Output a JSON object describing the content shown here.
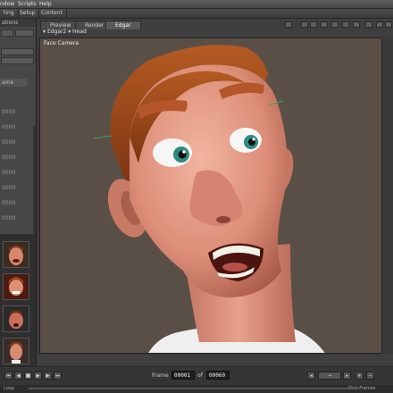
{
  "menu": {
    "items": [
      "ndow",
      "Scripts",
      "Help"
    ]
  },
  "topbar": {
    "tabs": [
      "ting",
      "Setup",
      "Content"
    ]
  },
  "left_panel": {
    "header": "ations",
    "button_labels": [
      "",
      "",
      "",
      ""
    ],
    "section_tab": "ame",
    "rows": [
      "0000",
      "0000",
      "0000",
      "0000",
      "0000",
      "0000",
      "0000",
      "0000"
    ],
    "thumbnails": [
      "face-1",
      "face-2",
      "face-3",
      "face-4"
    ]
  },
  "viewport": {
    "tabs": [
      "Preview",
      "Render",
      "Edgar"
    ],
    "active_tab": "Edgar",
    "figure": "Edgar2",
    "body_part": "Head",
    "camera": "Face Camera",
    "background_color": "#5a4f47"
  },
  "transport": {
    "frame_label": "Frame",
    "current_frame": "00001",
    "of_label": "of",
    "total_frames": "00060",
    "skip_frames": "Skip Frames",
    "loop": "Loop"
  }
}
